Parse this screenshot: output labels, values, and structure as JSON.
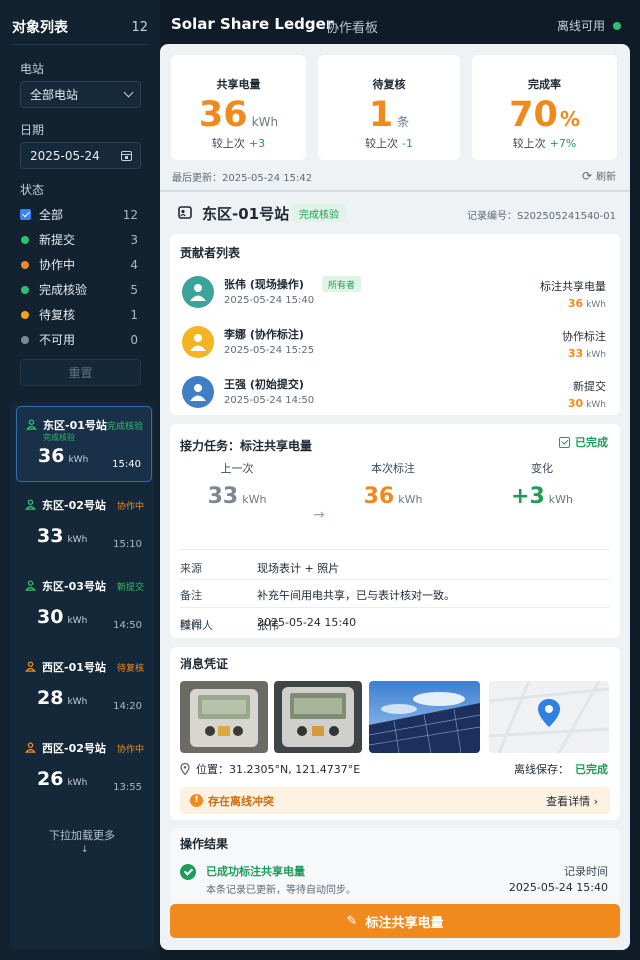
{
  "sidebar": {
    "title": "对象列表",
    "count": "12",
    "station_label": "电站",
    "station_value": "全部电站",
    "date_label": "日期",
    "date_value": "2025-05-24",
    "status_label": "状态",
    "statuses": [
      {
        "label": "全部",
        "count": "12",
        "color": "#3b82f6"
      },
      {
        "label": "新提交",
        "count": "3",
        "color": "#2fbf71"
      },
      {
        "label": "协作中",
        "count": "4",
        "color": "#f08a1c"
      },
      {
        "label": "完成核验",
        "count": "5",
        "color": "#2fbf71"
      },
      {
        "label": "待复核",
        "count": "1",
        "color": "#f0a51c"
      },
      {
        "label": "不可用",
        "count": "0",
        "color": "#7b8b98"
      }
    ],
    "reset_label": "重置",
    "stations": [
      {
        "name": "东区-01号站",
        "tag": "完成核验",
        "tag_color": "#2fbf71",
        "sub": "完成核验",
        "value": "36",
        "unit": "kWh",
        "time": "15:40"
      },
      {
        "name": "东区-02号站",
        "tag": "协作中",
        "tag_color": "#f08a1c",
        "value": "33",
        "unit": "kWh",
        "time": "15:10"
      },
      {
        "name": "东区-03号站",
        "tag": "新提交",
        "tag_color": "#2fbf71",
        "value": "30",
        "unit": "kWh",
        "time": "14:50"
      },
      {
        "name": "西区-01号站",
        "tag": "待复核",
        "tag_color": "#f08a1c",
        "value": "28",
        "unit": "kWh",
        "time": "14:20"
      },
      {
        "name": "西区-02号站",
        "tag": "协作中",
        "tag_color": "#f08a1c",
        "value": "26",
        "unit": "kWh",
        "time": "13:55"
      }
    ],
    "load_more": "下拉加载更多",
    "load_arrow": "↓"
  },
  "header": {
    "title": "Solar Share Ledger",
    "tab": "协作看板",
    "offline": "离线可用"
  },
  "stats": [
    {
      "title": "共享电量",
      "value": "36",
      "unit": "kWh",
      "compare": "较上次",
      "delta": "+3"
    },
    {
      "title": "待复核",
      "value": "1",
      "unit": "条",
      "compare": "较上次",
      "delta": "-1"
    },
    {
      "title": "完成率",
      "value": "70",
      "unit": "%",
      "compare": "较上次",
      "delta": "+7%"
    }
  ],
  "last_update": "最后更新：2025-05-24 15:42",
  "refresh": "刷新",
  "record": {
    "name": "东区-01号站",
    "badge": "完成核验",
    "id": "记录编号：S202505241540-01"
  },
  "contributors": {
    "title": "贡献者列表",
    "items": [
      {
        "name": "张伟 (现场操作)",
        "tag": "所有者",
        "time": "2025-05-24 15:40",
        "role": "标注共享电量",
        "value": "36",
        "unit": "kWh",
        "avatar_color": "#3aa39a"
      },
      {
        "name": "李娜 (协作标注)",
        "time": "2025-05-24 15:25",
        "role": "协作标注",
        "value": "33",
        "unit": "kWh",
        "avatar_color": "#f4b320"
      },
      {
        "name": "王强 (初始提交)",
        "time": "2025-05-24 14:50",
        "role": "新提交",
        "value": "30",
        "unit": "kWh",
        "avatar_color": "#3f7fc4"
      }
    ]
  },
  "task": {
    "title": "接力任务：标注共享电量",
    "status": "已完成",
    "prev_label": "上一次",
    "prev_value": "33",
    "cur_label": "本次标注",
    "cur_value": "36",
    "delta_label": "变化",
    "delta_value": "+3",
    "unit": "kWh",
    "arrow": "→",
    "source_key": "来源",
    "source_val": "现场表计 + 照片",
    "note_key": "备注",
    "note_val": "补充午间用电共享，已与表计核对一致。",
    "time_key": "时间",
    "time_val": "2025-05-24 15:40",
    "op_key": "操作人",
    "op_val": "张伟"
  },
  "evidence": {
    "title": "消息凭证",
    "location": "位置：31.2305°N, 121.4737°E",
    "offline_label": "离线保存：",
    "offline_val": "已完成",
    "conflict": "存在离线冲突",
    "detail": "查看详情 ›"
  },
  "result": {
    "title": "操作结果",
    "ok": "已成功标注共享电量",
    "desc": "本条记录已更新，等待自动同步。",
    "time_label": "记录时间",
    "time_val": "2025-05-24 15:40"
  },
  "action": {
    "label": "标注共享电量",
    "icon": "✎"
  },
  "colors": {
    "accent": "#f08a1c",
    "success": "#1e9c5a",
    "bg": "#0f1b26"
  }
}
